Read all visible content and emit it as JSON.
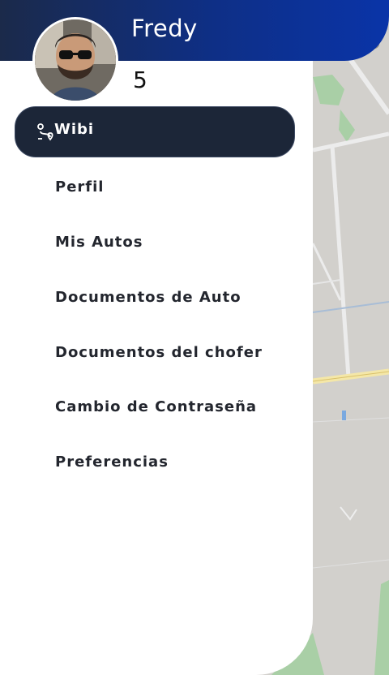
{
  "user": {
    "name": "Fredy",
    "rating": "5",
    "avatar": "profile-photo"
  },
  "menu": {
    "active": {
      "label": "Wibi",
      "icon": "route-icon"
    },
    "items": [
      {
        "label": "Perfil"
      },
      {
        "label": "Mis Autos"
      },
      {
        "label": "Documentos de Auto"
      },
      {
        "label": "Documentos del chofer"
      },
      {
        "label": "Cambio de Contraseña"
      },
      {
        "label": "Preferencias"
      }
    ]
  },
  "colors": {
    "header_start": "#1b2a4a",
    "header_end": "#0a34a8",
    "active_bg": "#1c2638",
    "map_bg": "#d2d0cc"
  }
}
